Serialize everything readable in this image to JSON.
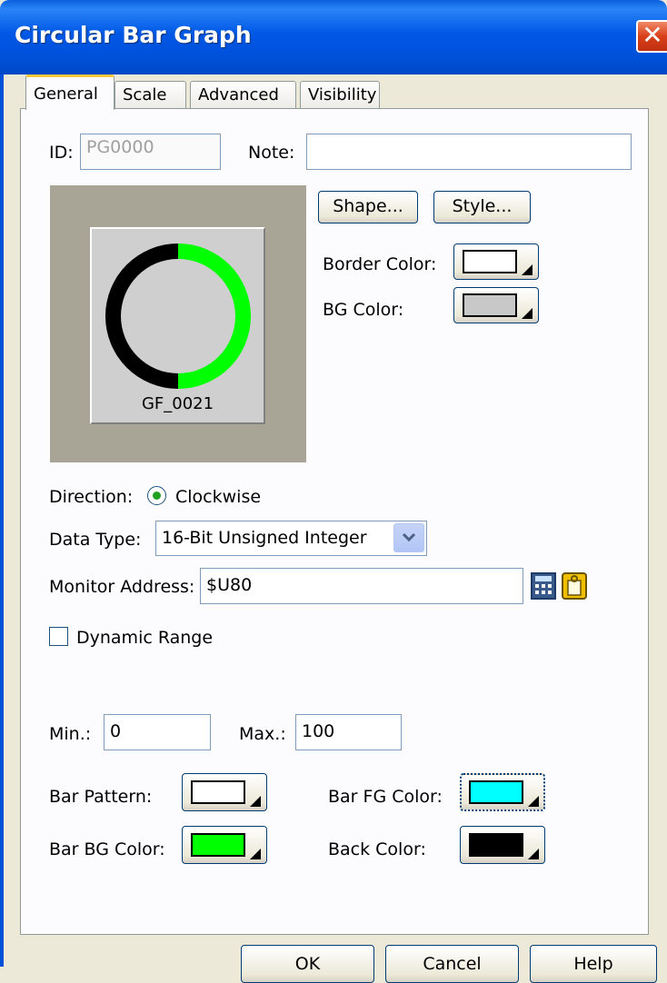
{
  "window": {
    "title": "Circular Bar Graph",
    "close_glyph": "✕"
  },
  "tabs": [
    {
      "label": "General",
      "active": true
    },
    {
      "label": "Scale",
      "active": false
    },
    {
      "label": "Advanced",
      "active": false
    },
    {
      "label": "Visibility",
      "active": false
    }
  ],
  "general": {
    "id_label": "ID:",
    "id_value": "PG0000",
    "note_label": "Note:",
    "note_value": "",
    "shape_button": "Shape...",
    "style_button": "Style...",
    "border_color_label": "Border Color:",
    "border_color": "#ffffff",
    "bg_color_label": "BG Color:",
    "bg_color": "#c8c8c8",
    "preview_caption": "GF_0021",
    "preview_fill_fraction": 0.5,
    "direction_label": "Direction:",
    "direction_value": "Clockwise",
    "data_type_label": "Data Type:",
    "data_type_value": "16-Bit Unsigned Integer",
    "monitor_address_label": "Monitor Address:",
    "monitor_address_value": "$U80",
    "dynamic_range_label": "Dynamic Range",
    "dynamic_range_checked": false,
    "min_label": "Min.:",
    "min_value": "0",
    "max_label": "Max.:",
    "max_value": "100",
    "bar_pattern_label": "Bar Pattern:",
    "bar_pattern_color": "#ffffff",
    "bar_fg_color_label": "Bar FG Color:",
    "bar_fg_color": "#00ffff",
    "bar_bg_color_label": "Bar BG Color:",
    "bar_bg_color": "#00ff00",
    "back_color_label": "Back Color:",
    "back_color": "#000000"
  },
  "footer": {
    "ok": "OK",
    "cancel": "Cancel",
    "help": "Help"
  },
  "icons": [
    "close-icon",
    "chevron-down-icon",
    "calculator-icon",
    "tag-icon",
    "radio-selected-icon"
  ]
}
